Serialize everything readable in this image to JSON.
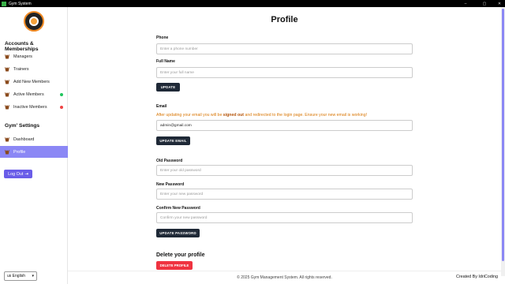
{
  "window": {
    "title": "Gym System",
    "controls": [
      "–",
      "▢",
      "✕"
    ]
  },
  "sidebar": {
    "section1_title": "Accounts & Memberships",
    "items": [
      {
        "label": "Managers"
      },
      {
        "label": "Trainers"
      },
      {
        "label": "Add New Members"
      },
      {
        "label": "Active Members",
        "dot_color": "#22c55e"
      },
      {
        "label": "Inactive Members",
        "dot_color": "#ef4444"
      }
    ],
    "section2_title": "Gym' Settings",
    "settings_items": [
      {
        "label": "Dashboard"
      },
      {
        "label": "Profile",
        "active": true
      }
    ],
    "logout_label": "Log Out",
    "language": "us English"
  },
  "main": {
    "title": "Profile",
    "phone": {
      "label": "Phone",
      "placeholder": "Enter a phone number"
    },
    "fullname": {
      "label": "Full Name",
      "placeholder": "Enter your full name"
    },
    "update_label": "UPDATE",
    "email": {
      "label": "Email",
      "warning_pre": "After updating your email you will be ",
      "warning_bold": "signed out",
      "warning_post": " and redirected to the login page. Ensure your new email is working!",
      "value": "admin@gmail.com"
    },
    "update_email_label": "UPDATE EMAIL",
    "old_password": {
      "label": "Old Password",
      "placeholder": "Enter your old password"
    },
    "new_password": {
      "label": "New Password",
      "placeholder": "Enter your new password"
    },
    "confirm_password": {
      "label": "Confirm New Password",
      "placeholder": "Confirm your new password"
    },
    "update_password_label": "UPDATE PASSWORD",
    "delete_title": "Delete your profile",
    "delete_label": "DELETE PROFILE"
  },
  "footer": {
    "copyright": "© 2025 Gym Management System. All rights reserved.",
    "credit": "Created By IdriCoding"
  },
  "colors": {
    "accent": "#8b87f5",
    "logout": "#6a5de8",
    "dark_button": "#1f2937",
    "danger": "#ef3340",
    "warning": "#d97706"
  }
}
